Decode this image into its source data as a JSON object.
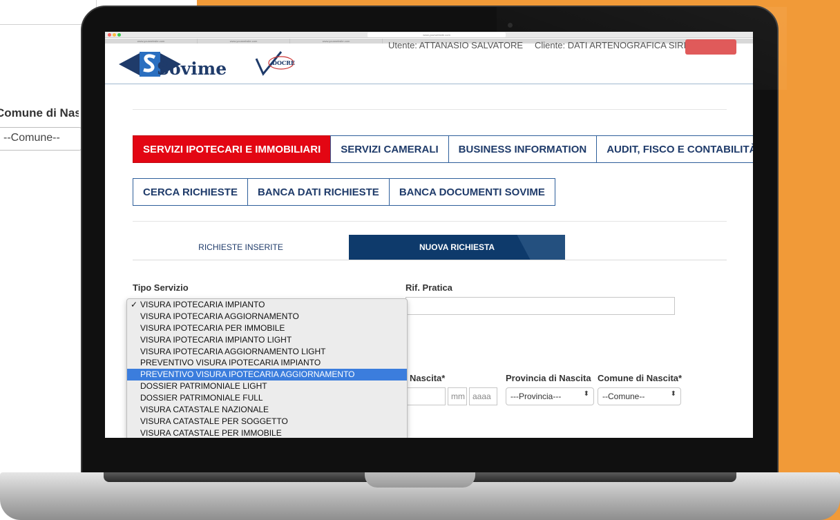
{
  "background": {
    "zoom_label": "Comune di Nascita",
    "zoom_select": "--Comune--"
  },
  "browser": {
    "url": "www.yourwebsite.com",
    "tabs": [
      "www.yourwebsite.com",
      "www.yourwebsite.com",
      "www.yourwebsite.com"
    ]
  },
  "header": {
    "logo_text": "Sovime",
    "docrey_label": "DOCREY",
    "user_1": "Utente: ATTANASIO SALVATORE",
    "user_2": "Cliente: DATI ARTENOGRAFICA SIRIE"
  },
  "main_nav": [
    {
      "label": "SERVIZI IPOTECARI E IMMOBILIARI",
      "active": true
    },
    {
      "label": "SERVIZI CAMERALI",
      "active": false
    },
    {
      "label": "BUSINESS INFORMATION",
      "active": false
    },
    {
      "label": "AUDIT, FISCO E CONTABILITÀ",
      "active": false
    }
  ],
  "sub_nav": [
    {
      "label": "CERCA RICHIESTE"
    },
    {
      "label": "BANCA DATI RICHIESTE"
    },
    {
      "label": "BANCA DOCUMENTI SOVIME"
    }
  ],
  "tabs": {
    "inserite": "RICHIESTE INSERITE",
    "nuova": "NUOVA RICHIESTA"
  },
  "form": {
    "tipo_servizio_label": "Tipo Servizio",
    "rif_pratica_label": "Rif. Pratica",
    "data_nascita_label": "Nascita*",
    "provincia_label": "Provincia di Nascita",
    "comune_label": "Comune di Nascita*",
    "month_placeholder": "mm",
    "year_placeholder": "aaaa",
    "provincia_value": "---Provincia---",
    "comune_value": "--Comune--"
  },
  "dropdown": {
    "check": "✓",
    "selected_index": 6,
    "options": [
      "VISURA IPOTECARIA IMPIANTO",
      "VISURA IPOTECARIA AGGIORNAMENTO",
      "VISURA IPOTECARIA PER IMMOBILE",
      "VISURA IPOTECARIA IMPIANTO LIGHT",
      "VISURA IPOTECARIA AGGIORNAMENTO LIGHT",
      "PREVENTIVO VISURA IPOTECARIA IMPIANTO",
      "PREVENTIVO VISURA IPOTECARIA AGGIORNAMENTO",
      "DOSSIER PATRIMONIALE LIGHT",
      "DOSSIER PATRIMONIALE FULL",
      "VISURA CATASTALE NAZIONALE",
      "VISURA CATASTALE PER SOGGETTO",
      "VISURA CATASTALE PER IMMOBILE"
    ]
  },
  "colors": {
    "accent_red": "#e30613",
    "navy": "#0e3a6b",
    "orange_bg": "#f19a38",
    "selection_blue": "#3b7ddd"
  }
}
